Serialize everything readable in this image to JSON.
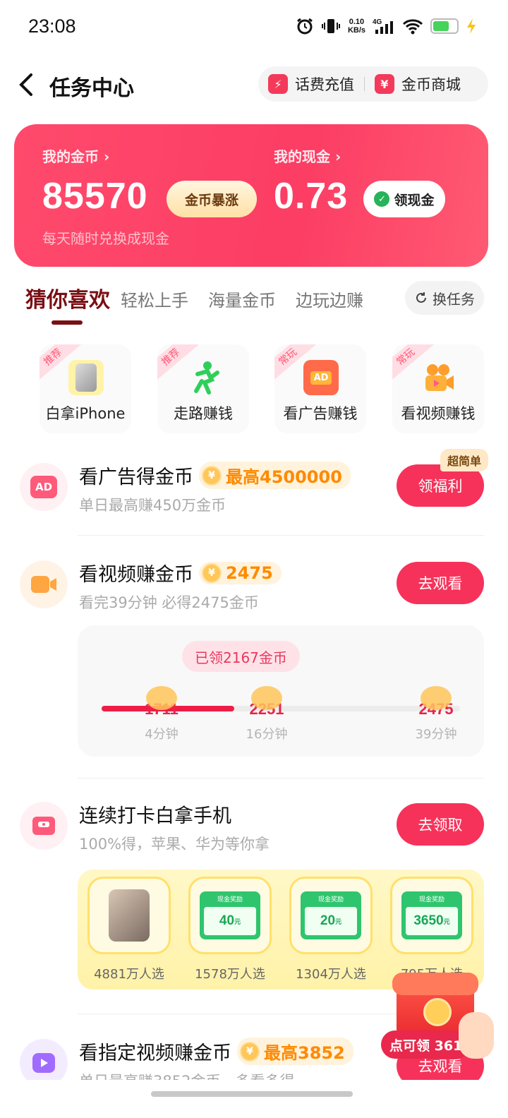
{
  "status": {
    "time": "23:08",
    "net_speed": "0.10",
    "net_unit": "KB/s",
    "network": "4G"
  },
  "header": {
    "title": "任务中心",
    "topup_label": "话费充值",
    "mall_label": "金币商城",
    "mall_icon_text": "¥"
  },
  "wallet": {
    "coins_label": "我的金币 ›",
    "coins_value": "85570",
    "surge_btn": "金币暴涨",
    "cash_label": "我的现金 ›",
    "cash_value": "0.73",
    "withdraw_btn": "领现金",
    "subtitle": "每天随时兑换成现金"
  },
  "tabs": [
    "猜你喜欢",
    "轻松上手",
    "海量金币",
    "边玩边赚"
  ],
  "swap_btn": "换任务",
  "categories": [
    {
      "tag": "推荐",
      "label": "白拿iPhone",
      "icon": "iphone-icon"
    },
    {
      "tag": "推荐",
      "label": "走路赚钱",
      "icon": "walking-person-icon"
    },
    {
      "tag": "常玩",
      "label": "看广告赚钱",
      "icon": "tv-ad-icon",
      "icon_text": "AD"
    },
    {
      "tag": "常玩",
      "label": "看视频赚钱",
      "icon": "video-camera-icon"
    }
  ],
  "tasks": [
    {
      "title": "看广告得金币",
      "reward": "最高4500000",
      "subtitle": "单日最高赚450万金币",
      "button": "领福利",
      "badge": "超简单",
      "icon": "ad-icon",
      "icon_text": "AD"
    },
    {
      "title": "看视频赚金币",
      "reward": "2475",
      "subtitle": "看完39分钟 必得2475金币",
      "button": "去观看",
      "icon": "video-icon"
    },
    {
      "title": "连续打卡白拿手机",
      "subtitle": "100%得，苹果、华为等你拿",
      "button": "去领取",
      "icon": "wallet-icon"
    },
    {
      "title": "看指定视频赚金币",
      "reward": "最高3852",
      "subtitle": "单日最高赚3852金币　多看多得",
      "button": "去观看",
      "icon": "play-icon"
    }
  ],
  "video_progress": {
    "claimed_label": "已领2167金币",
    "progress_fraction": 0.37,
    "milestones": [
      {
        "value": "1711",
        "time": "4分钟"
      },
      {
        "value": "2251",
        "time": "16分钟"
      },
      {
        "value": "2475",
        "time": "39分钟"
      }
    ]
  },
  "checkin_prizes": [
    {
      "kind": "phone",
      "caption": "4881万人选"
    },
    {
      "kind": "cash",
      "card_title": "现金奖励",
      "amount": "40",
      "unit": "元",
      "caption": "1578万人选"
    },
    {
      "kind": "cash",
      "card_title": "现金奖励",
      "amount": "20",
      "unit": "元",
      "caption": "1304万人选"
    },
    {
      "kind": "cash",
      "card_title": "现金奖励",
      "amount": "3650",
      "unit": "元",
      "caption": "795万人选"
    }
  ],
  "floating_gift": {
    "label": "点可领 361"
  },
  "colors": {
    "brand_red": "#f6325a",
    "coin_orange": "#ff8a00",
    "tab_active": "#7a0f14"
  }
}
